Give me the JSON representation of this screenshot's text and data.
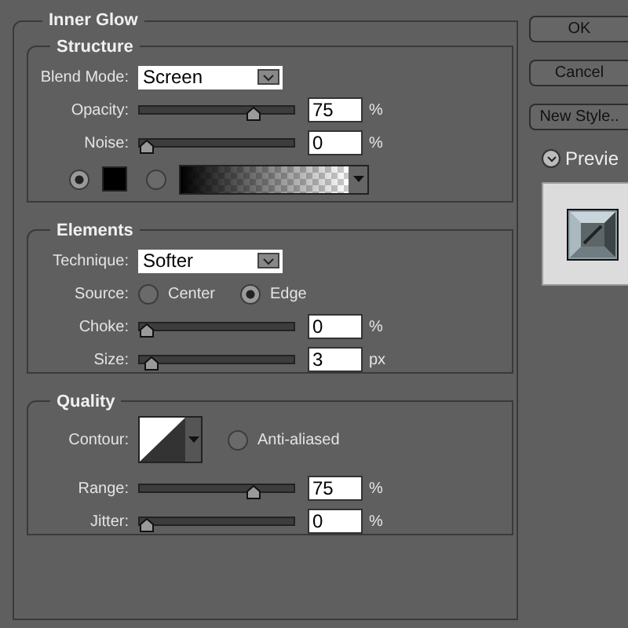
{
  "group": {
    "title": "Inner Glow"
  },
  "sections": [
    {
      "title": "Structure",
      "rows": [
        {
          "kind": "dropdown",
          "label": "Blend Mode:",
          "value": "Screen"
        },
        {
          "kind": "slider",
          "label": "Opacity:",
          "level": 0.75,
          "value": "75",
          "unit": "%"
        },
        {
          "kind": "slider",
          "label": "Noise:",
          "level": 0,
          "value": "0",
          "unit": "%"
        },
        {
          "kind": "fill",
          "options": [
            {
              "kind": "color",
              "selected": true,
              "color": "#000000"
            },
            {
              "kind": "gradient",
              "selected": false
            }
          ]
        }
      ]
    },
    {
      "title": "Elements",
      "rows": [
        {
          "kind": "dropdown",
          "label": "Technique:",
          "value": "Softer"
        },
        {
          "kind": "radio",
          "label": "Source:",
          "options": [
            {
              "label": "Center",
              "selected": false
            },
            {
              "label": "Edge",
              "selected": true
            }
          ]
        },
        {
          "kind": "slider",
          "label": "Choke:",
          "level": 0,
          "value": "0",
          "unit": "%"
        },
        {
          "kind": "slider",
          "label": "Size:",
          "level": 0.03,
          "value": "3",
          "unit": "px"
        }
      ]
    },
    {
      "title": "Quality",
      "rows": [
        {
          "kind": "contour",
          "label": "Contour:",
          "option": {
            "label": "Anti-aliased",
            "checked": false
          }
        },
        {
          "kind": "slider",
          "label": "Range:",
          "level": 0.75,
          "value": "75",
          "unit": "%"
        },
        {
          "kind": "slider",
          "label": "Jitter:",
          "level": 0,
          "value": "0",
          "unit": "%"
        }
      ]
    }
  ],
  "buttons": [
    "OK",
    "Cancel",
    "New Style.."
  ],
  "preview": {
    "label": "Previe",
    "checked": true
  }
}
